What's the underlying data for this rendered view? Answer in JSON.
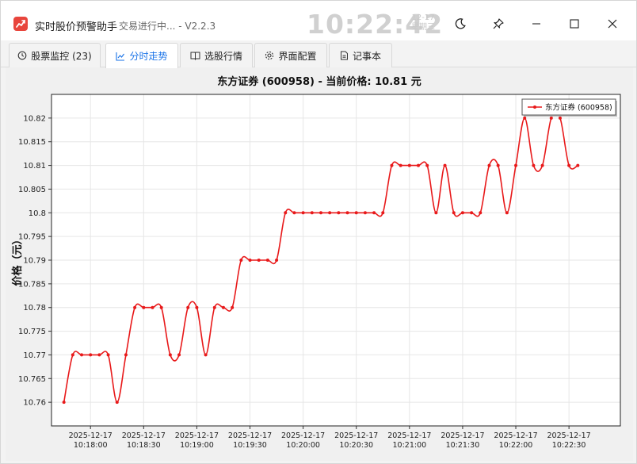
{
  "titlebar": {
    "app_name": "实时股价预警助手",
    "status": "交易进行中... - V2.2.3",
    "clock_time": "10:22:42",
    "clock_date": "12-17",
    "clock_weekday": "星期三",
    "icons": {
      "app": "chart-trend-icon",
      "theme": "moon-icon",
      "pin": "pin-icon",
      "minimize": "minimize-icon",
      "maximize": "maximize-icon",
      "close": "close-icon"
    }
  },
  "tabs": [
    {
      "label": "股票监控 (23)",
      "icon": "clock-icon",
      "active": false
    },
    {
      "label": "分时走势",
      "icon": "line-chart-icon",
      "active": true
    },
    {
      "label": "选股行情",
      "icon": "book-icon",
      "active": false
    },
    {
      "label": "界面配置",
      "icon": "gear-icon",
      "active": false
    },
    {
      "label": "记事本",
      "icon": "note-icon",
      "active": false
    }
  ],
  "colors": {
    "accent": "#1a73e8",
    "series": "#e8191a",
    "app_icon": "#e8453c"
  },
  "chart_data": {
    "type": "line",
    "title": "东方证券 (600958) - 当前价格: 10.81 元",
    "ylabel": "价格（元）",
    "xlabel": "",
    "ylim": [
      10.755,
      10.825
    ],
    "yticks": [
      "10.76",
      "10.765",
      "10.77",
      "10.775",
      "10.78",
      "10.785",
      "10.79",
      "10.795",
      "10.8",
      "10.805",
      "10.81",
      "10.815",
      "10.82"
    ],
    "xticks": [
      {
        "date": "2025-12-17",
        "time": "10:18:00"
      },
      {
        "date": "2025-12-17",
        "time": "10:18:30"
      },
      {
        "date": "2025-12-17",
        "time": "10:19:00"
      },
      {
        "date": "2025-12-17",
        "time": "10:19:30"
      },
      {
        "date": "2025-12-17",
        "time": "10:20:00"
      },
      {
        "date": "2025-12-17",
        "time": "10:20:30"
      },
      {
        "date": "2025-12-17",
        "time": "10:21:00"
      },
      {
        "date": "2025-12-17",
        "time": "10:21:30"
      },
      {
        "date": "2025-12-17",
        "time": "10:22:00"
      },
      {
        "date": "2025-12-17",
        "time": "10:22:30"
      }
    ],
    "legend": "top-right",
    "grid": true,
    "series": [
      {
        "name": "东方证券 (600958)",
        "x": [
          "10:17:45",
          "10:17:50",
          "10:17:55",
          "10:18:00",
          "10:18:05",
          "10:18:10",
          "10:18:15",
          "10:18:20",
          "10:18:25",
          "10:18:30",
          "10:18:35",
          "10:18:40",
          "10:18:45",
          "10:18:50",
          "10:18:55",
          "10:19:00",
          "10:19:05",
          "10:19:10",
          "10:19:15",
          "10:19:20",
          "10:19:25",
          "10:19:30",
          "10:19:35",
          "10:19:40",
          "10:19:45",
          "10:19:50",
          "10:19:55",
          "10:20:00",
          "10:20:05",
          "10:20:10",
          "10:20:15",
          "10:20:20",
          "10:20:25",
          "10:20:30",
          "10:20:35",
          "10:20:40",
          "10:20:45",
          "10:20:50",
          "10:20:55",
          "10:21:00",
          "10:21:05",
          "10:21:10",
          "10:21:15",
          "10:21:20",
          "10:21:25",
          "10:21:30",
          "10:21:35",
          "10:21:40",
          "10:21:45",
          "10:21:50",
          "10:21:55",
          "10:22:00",
          "10:22:05",
          "10:22:10",
          "10:22:15",
          "10:22:20",
          "10:22:25",
          "10:22:30",
          "10:22:35"
        ],
        "values": [
          10.76,
          10.77,
          10.77,
          10.77,
          10.77,
          10.77,
          10.76,
          10.77,
          10.78,
          10.78,
          10.78,
          10.78,
          10.77,
          10.77,
          10.78,
          10.78,
          10.77,
          10.78,
          10.78,
          10.78,
          10.79,
          10.79,
          10.79,
          10.79,
          10.79,
          10.8,
          10.8,
          10.8,
          10.8,
          10.8,
          10.8,
          10.8,
          10.8,
          10.8,
          10.8,
          10.8,
          10.8,
          10.81,
          10.81,
          10.81,
          10.81,
          10.81,
          10.8,
          10.81,
          10.8,
          10.8,
          10.8,
          10.8,
          10.81,
          10.81,
          10.8,
          10.81,
          10.82,
          10.81,
          10.81,
          10.82,
          10.82,
          10.81,
          10.81
        ]
      }
    ]
  }
}
